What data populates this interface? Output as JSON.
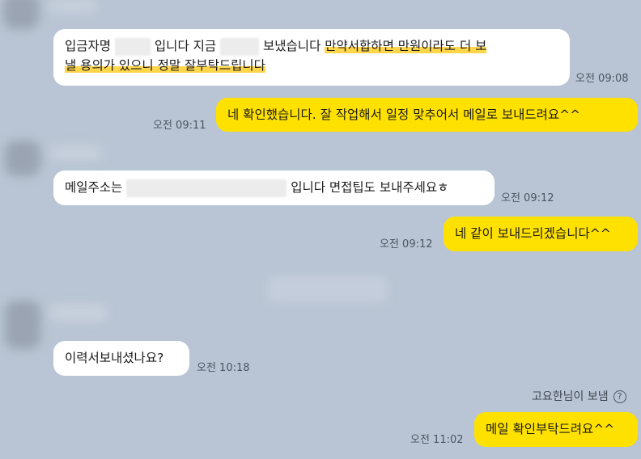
{
  "messages": [
    {
      "id": "m1",
      "side": "received",
      "time": "오전 09:08",
      "parts": {
        "p1": "입금자명",
        "p2": "입니다 지금",
        "p3": "보냈습니다 ",
        "p4": "만약서합하면 만원이라도 더 보",
        "line2": "낼 용의가 있으니 정말 잘부탁드립니다"
      }
    },
    {
      "id": "m2",
      "side": "sent",
      "time": "오전 09:11",
      "text": "네 확인했습니다. 잘 작업해서 일정 맞추어서 메일로 보내드려요^^"
    },
    {
      "id": "m3",
      "side": "received",
      "time": "오전 09:12",
      "parts": {
        "p1": "메일주소는",
        "p2": "입니다 면접팁도 보내주세요ㅎ"
      }
    },
    {
      "id": "m4",
      "side": "sent",
      "time": "오전 09:12",
      "text": "네 같이 보내드리겠습니다^^"
    },
    {
      "id": "m5",
      "side": "received",
      "time": "오전 10:18",
      "text": "이력서보내셨나요?"
    },
    {
      "id": "m6",
      "side": "sent",
      "time": "오전 11:02",
      "text": "메일 확인부탁드려요^^"
    }
  ],
  "sender_note": {
    "text": "고요한님이 보냄",
    "icon": "help-circle-icon"
  },
  "colors": {
    "background": "#b9c5d4",
    "sent_bubble": "#ffe100",
    "received_bubble": "#ffffff",
    "highlight": "#ffd54a"
  }
}
